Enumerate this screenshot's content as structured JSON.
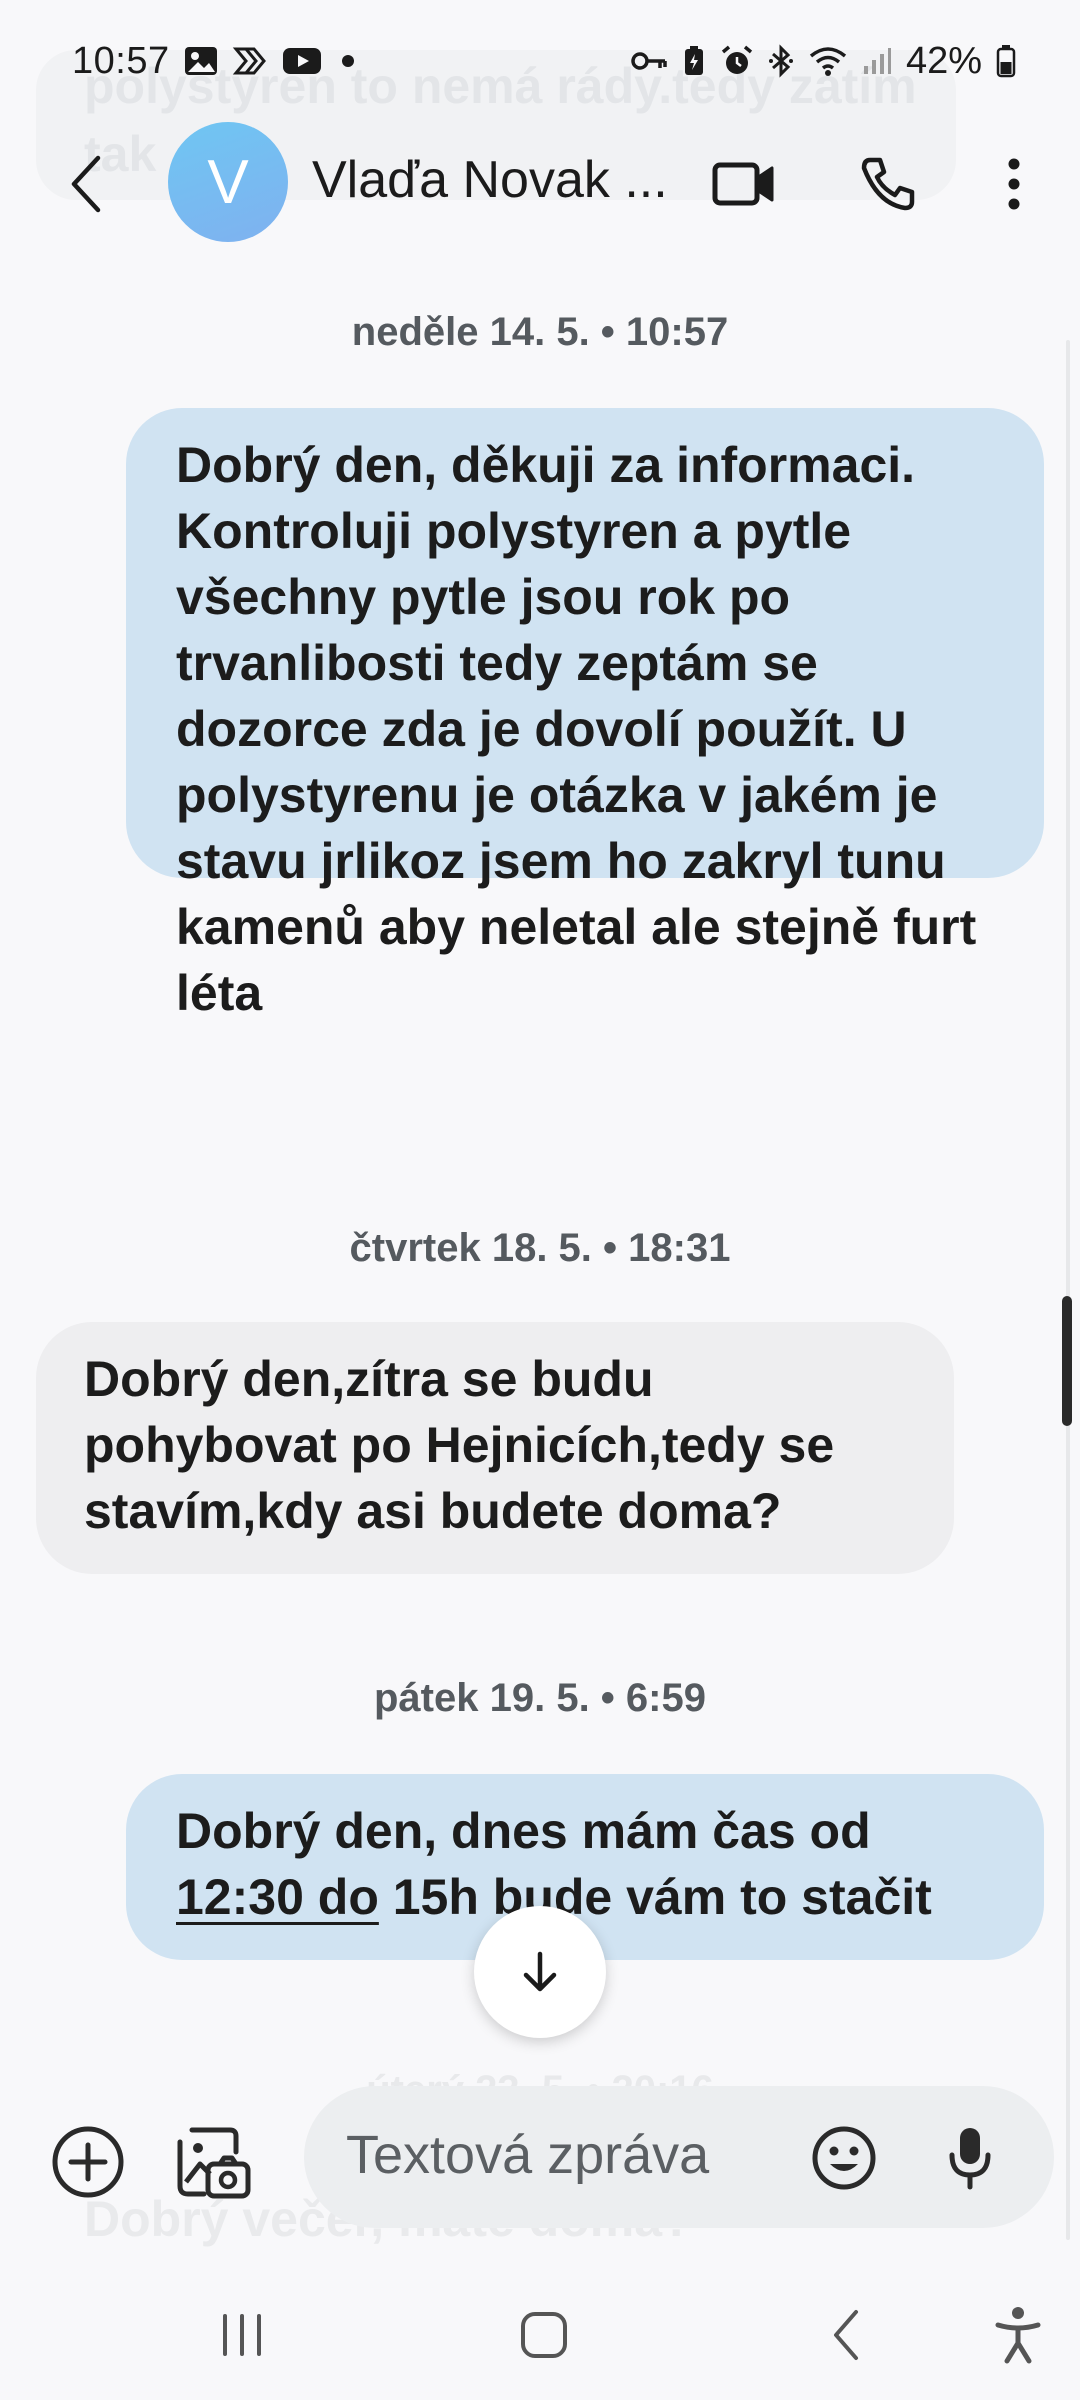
{
  "status_bar": {
    "time": "10:57",
    "battery": "42%",
    "left_icons": [
      "gallery-icon",
      "stylus-icon",
      "youtube-icon",
      "dot-icon"
    ],
    "right_icons": [
      "vpn-key-icon",
      "battery-saver-icon",
      "alarm-icon",
      "bluetooth-icon",
      "wifi-icon",
      "signal-icon",
      "battery-icon"
    ]
  },
  "ghost_top": {
    "text": "polystyren to nemá rády.tedy zatím tak"
  },
  "header": {
    "avatar_letter": "V",
    "contact_name": "Vlaďa Novak ...",
    "colors": {
      "avatar": "#74b9f1"
    }
  },
  "messages": [
    {
      "type": "date",
      "text": "neděle 14. 5. • 10:57"
    },
    {
      "type": "outgoing",
      "text": "Dobrý den,  děkuji za informaci. Kontroluji polystyren a pytle všechny pytle jsou rok po trvanlibosti tedy zeptám se dozorce zda je dovolí použít. U polystyrenu je otázka v jakém je stavu  jrlikoz jsem ho zakryl tunu kamenů aby neletal ale stejně furt léta"
    },
    {
      "type": "date",
      "text": "čtvrtek 18. 5. • 18:31"
    },
    {
      "type": "incoming",
      "text": "Dobrý den,zítra se budu pohybovat po Hejnicích,tedy se stavím,kdy asi budete doma?"
    },
    {
      "type": "date",
      "text": "pátek 19. 5. • 6:59"
    },
    {
      "type": "outgoing",
      "line1": "Dobrý den, dnes mám čas od",
      "link": "12:30 do",
      "rest": " 15h bude vám to stačit"
    }
  ],
  "ghost_bottom": {
    "date": "úterý 23. 5. • 20:16",
    "text": "Dobrý večer, máte doma?"
  },
  "composer": {
    "placeholder": "Textová zpráva"
  },
  "colors": {
    "outgoing_bubble": "#d0e3f2",
    "incoming_bubble": "#eeeef0",
    "background": "#f8f8fa"
  }
}
